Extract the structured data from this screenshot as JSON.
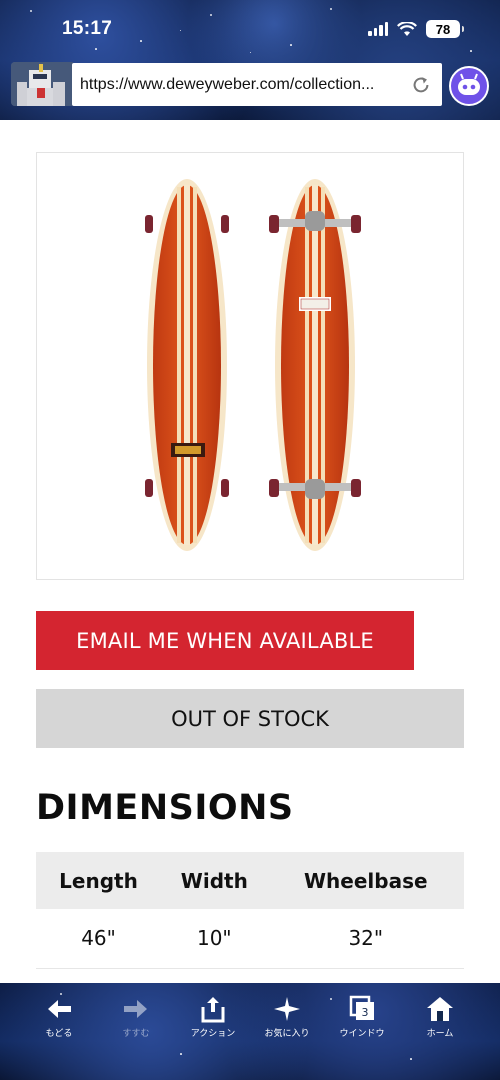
{
  "status_bar": {
    "time": "15:17",
    "battery": "78"
  },
  "browser": {
    "url": "https://www.deweyweber.com/collection..."
  },
  "product": {
    "email_button_label": "EMAIL ME WHEN AVAILABLE",
    "stock_button_label": "OUT OF STOCK",
    "board_label": "Dewey Weber"
  },
  "dimensions": {
    "title": "DIMENSIONS",
    "headers": [
      "Length",
      "Width",
      "Wheelbase"
    ],
    "values": [
      "46\"",
      "10\"",
      "32\""
    ]
  },
  "toolbar": {
    "items": [
      {
        "label": "もどる",
        "icon": "back-arrow-icon"
      },
      {
        "label": "すすむ",
        "icon": "forward-arrow-icon"
      },
      {
        "label": "アクション",
        "icon": "share-icon"
      },
      {
        "label": "お気に入り",
        "icon": "bookmark-icon"
      },
      {
        "label": "ウインドウ",
        "icon": "windows-icon"
      },
      {
        "label": "ホーム",
        "icon": "home-icon"
      }
    ],
    "window_count": "3"
  },
  "colors": {
    "accent_red": "#d42530",
    "stock_gray": "#d6d6d6"
  }
}
